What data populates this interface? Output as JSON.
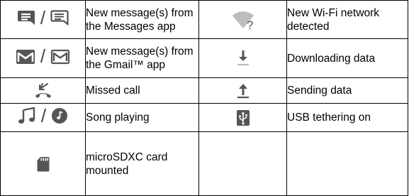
{
  "separator": "/",
  "colors": {
    "icon_gray": "#555555",
    "text": "#000000",
    "border": "#000000"
  },
  "rows": [
    {
      "left": {
        "icons": [
          "messages-icon",
          "messages-outline-icon"
        ],
        "text": "New message(s) from the Messages app"
      },
      "right": {
        "icons": [
          "wifi-question-icon"
        ],
        "text": "New Wi-Fi network detected"
      }
    },
    {
      "left": {
        "icons": [
          "gmail-icon",
          "gmail-outline-icon"
        ],
        "text": "New message(s) from the Gmail™ app"
      },
      "right": {
        "icons": [
          "download-icon"
        ],
        "text": "Downloading data"
      }
    },
    {
      "left": {
        "icons": [
          "missed-call-icon"
        ],
        "text": "Missed call"
      },
      "right": {
        "icons": [
          "upload-icon"
        ],
        "text": "Sending data"
      }
    },
    {
      "left": {
        "icons": [
          "music-note-icon",
          "music-disc-icon"
        ],
        "text": "Song playing"
      },
      "right": {
        "icons": [
          "usb-tether-icon"
        ],
        "text": "USB tethering on"
      }
    },
    {
      "left": {
        "icons": [
          "sd-card-icon"
        ],
        "text": "microSDXC card mounted"
      },
      "right": {
        "icons": [],
        "text": ""
      }
    }
  ]
}
